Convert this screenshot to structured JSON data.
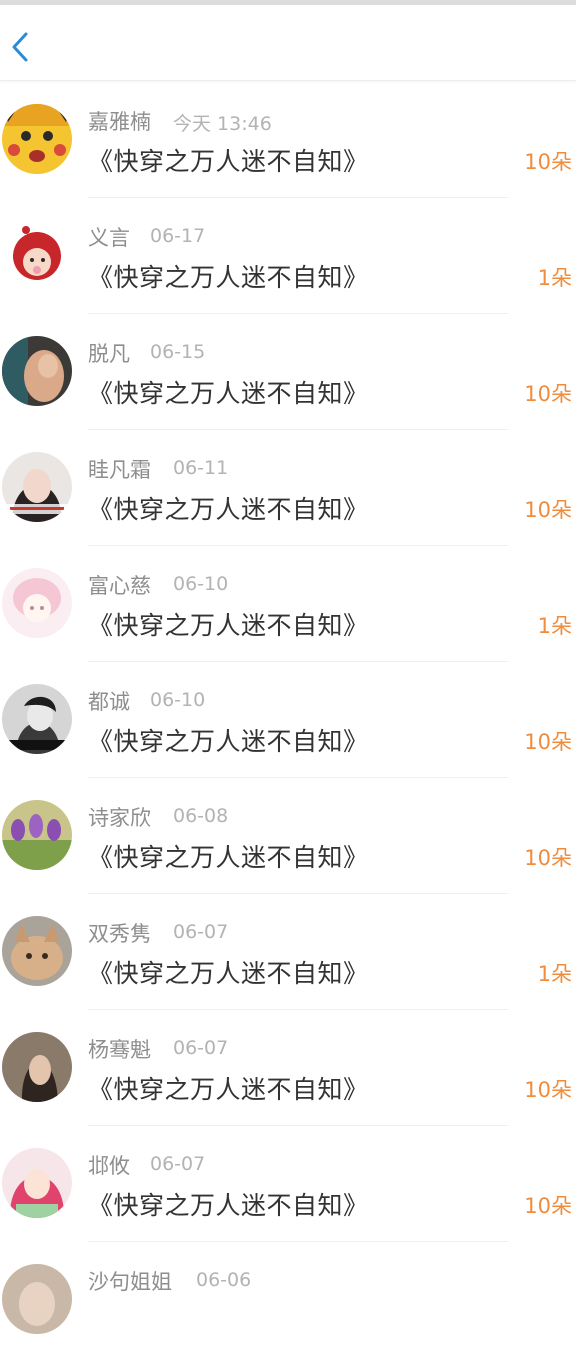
{
  "header": {
    "back_icon": "chevron-left-icon",
    "accent_color": "#2a8cd6"
  },
  "colors": {
    "amount": "#f08c3c",
    "name": "#8e8e8e",
    "date": "#b3b3b3",
    "title": "#333333"
  },
  "records": [
    {
      "name": "嘉雅楠",
      "date": "今天 13:46",
      "title": "《快穿之万人迷不自知》",
      "amount": "10朵"
    },
    {
      "name": "义言",
      "date": "06-17",
      "title": "《快穿之万人迷不自知》",
      "amount": "1朵"
    },
    {
      "name": "脱凡",
      "date": "06-15",
      "title": "《快穿之万人迷不自知》",
      "amount": "10朵"
    },
    {
      "name": "眭凡霜",
      "date": "06-11",
      "title": "《快穿之万人迷不自知》",
      "amount": "10朵"
    },
    {
      "name": "富心慈",
      "date": "06-10",
      "title": "《快穿之万人迷不自知》",
      "amount": "1朵"
    },
    {
      "name": "都诚",
      "date": "06-10",
      "title": "《快穿之万人迷不自知》",
      "amount": "10朵"
    },
    {
      "name": "诗家欣",
      "date": "06-08",
      "title": "《快穿之万人迷不自知》",
      "amount": "10朵"
    },
    {
      "name": "双秀隽",
      "date": "06-07",
      "title": "《快穿之万人迷不自知》",
      "amount": "1朵"
    },
    {
      "name": "杨骞魁",
      "date": "06-07",
      "title": "《快穿之万人迷不自知》",
      "amount": "10朵"
    },
    {
      "name": "邶攸",
      "date": "06-07",
      "title": "《快穿之万人迷不自知》",
      "amount": "10朵"
    },
    {
      "name": "沙句姐姐",
      "date": "06-06",
      "title": "",
      "amount": ""
    }
  ]
}
